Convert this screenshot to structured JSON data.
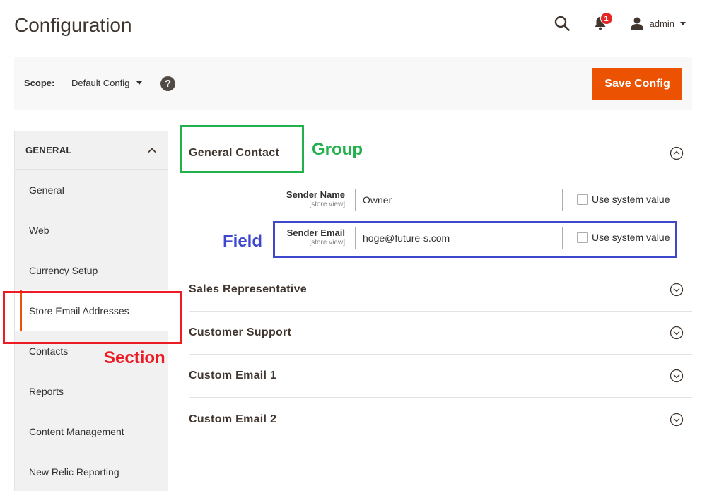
{
  "header": {
    "title": "Configuration",
    "notification_count": "1",
    "user_name": "admin"
  },
  "scope_bar": {
    "label": "Scope:",
    "selected": "Default Config",
    "help": "?",
    "save_label": "Save Config"
  },
  "sidebar": {
    "section_title": "GENERAL",
    "items": [
      {
        "label": "General"
      },
      {
        "label": "Web"
      },
      {
        "label": "Currency Setup"
      },
      {
        "label": "Store Email Addresses"
      },
      {
        "label": "Contacts"
      },
      {
        "label": "Reports"
      },
      {
        "label": "Content Management"
      },
      {
        "label": "New Relic Reporting"
      }
    ],
    "active_index": 3
  },
  "groups": {
    "general_contact": {
      "title": "General Contact",
      "fields": [
        {
          "label": "Sender Name",
          "scope": "[store view]",
          "value": "Owner",
          "checkbox_label": "Use system value"
        },
        {
          "label": "Sender Email",
          "scope": "[store view]",
          "value": "hoge@future-s.com",
          "checkbox_label": "Use system value"
        }
      ]
    },
    "collapsed": [
      {
        "title": "Sales Representative"
      },
      {
        "title": "Customer Support"
      },
      {
        "title": "Custom Email 1"
      },
      {
        "title": "Custom Email 2"
      }
    ]
  },
  "annotations": {
    "group": {
      "text": "Group",
      "color": "#22b14c"
    },
    "field": {
      "text": "Field",
      "color": "#3f48cc"
    },
    "section": {
      "text": "Section",
      "color": "#ed1c24"
    }
  },
  "colors": {
    "accent": "#eb5202",
    "badge": "#e22626"
  }
}
